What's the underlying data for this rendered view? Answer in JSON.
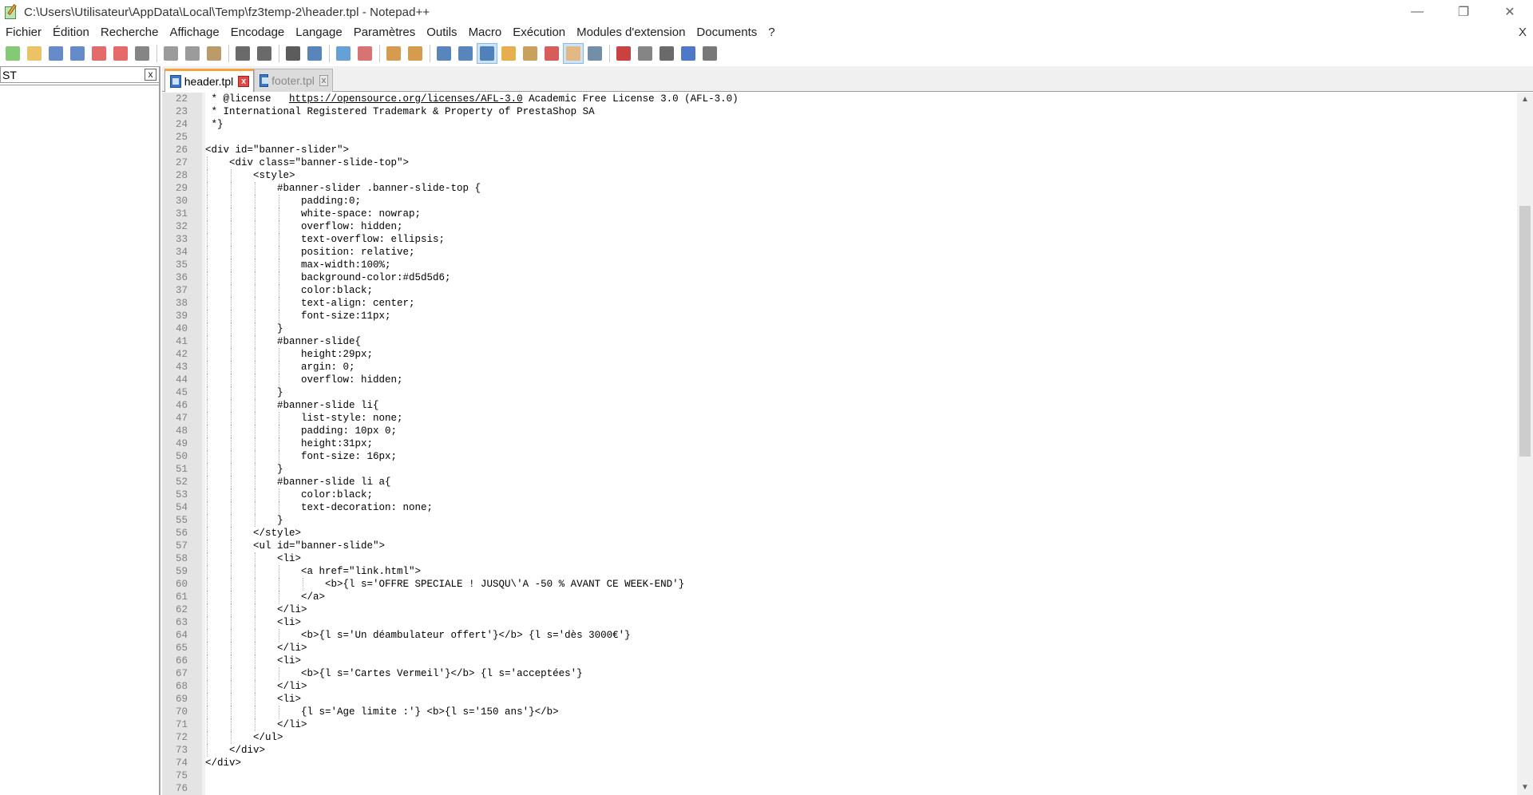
{
  "window": {
    "title": "C:\\Users\\Utilisateur\\AppData\\Local\\Temp\\fz3temp-2\\header.tpl - Notepad++",
    "minimize": "—",
    "restore": "❐",
    "close": "✕"
  },
  "menu": {
    "items": [
      "Fichier",
      "Édition",
      "Recherche",
      "Affichage",
      "Encodage",
      "Langage",
      "Paramètres",
      "Outils",
      "Macro",
      "Exécution",
      "Modules d'extension",
      "Documents",
      "?"
    ],
    "close": "X"
  },
  "toolbar": {
    "buttons": [
      {
        "name": "new-file",
        "color": "#6fbf5a"
      },
      {
        "name": "open-file",
        "color": "#e6b94a"
      },
      {
        "name": "save",
        "color": "#4a78c0"
      },
      {
        "name": "save-all",
        "color": "#4a78c0"
      },
      {
        "name": "close",
        "color": "#e05050"
      },
      {
        "name": "close-all",
        "color": "#e05050"
      },
      {
        "name": "print",
        "color": "#707070"
      },
      {
        "sep": true
      },
      {
        "name": "cut",
        "color": "#8a8a8a"
      },
      {
        "name": "copy",
        "color": "#8a8a8a"
      },
      {
        "name": "paste",
        "color": "#b08a50"
      },
      {
        "sep": true
      },
      {
        "name": "undo",
        "color": "#505050"
      },
      {
        "name": "redo",
        "color": "#505050"
      },
      {
        "sep": true
      },
      {
        "name": "find",
        "color": "#404040"
      },
      {
        "name": "replace",
        "color": "#3a70b0"
      },
      {
        "sep": true
      },
      {
        "name": "zoom-in",
        "color": "#4a90d0"
      },
      {
        "name": "zoom-out",
        "color": "#d05a5a"
      },
      {
        "sep": true
      },
      {
        "name": "sync-vertical",
        "color": "#d08a30"
      },
      {
        "name": "sync-horizontal",
        "color": "#d08a30"
      },
      {
        "sep": true
      },
      {
        "name": "word-wrap",
        "color": "#3a70b0"
      },
      {
        "name": "show-all-chars",
        "color": "#3a70b0"
      },
      {
        "name": "indent-guide",
        "color": "#3a70b0",
        "active": true
      },
      {
        "name": "user-language",
        "color": "#e0a030"
      },
      {
        "name": "doc-map",
        "color": "#c09040"
      },
      {
        "name": "function-list",
        "color": "#d04040"
      },
      {
        "name": "folder-workspace",
        "color": "#e8b070",
        "active": true
      },
      {
        "name": "monitoring",
        "color": "#5a7a9a"
      },
      {
        "sep": true
      },
      {
        "name": "macro-record",
        "color": "#c02020"
      },
      {
        "name": "macro-stop",
        "color": "#707070"
      },
      {
        "name": "macro-play",
        "color": "#505050"
      },
      {
        "name": "macro-play-multiple",
        "color": "#3060c0"
      },
      {
        "name": "macro-save",
        "color": "#606060"
      }
    ]
  },
  "left_panel": {
    "search_value": "ST",
    "close": "x"
  },
  "tabs": [
    {
      "label": "header.tpl",
      "active": true,
      "close": "x"
    },
    {
      "label": "footer.tpl",
      "active": false,
      "close": "x"
    }
  ],
  "editor": {
    "lines": [
      {
        "n": "22",
        "indent": 0,
        "text": " * @license   ",
        "link": "https://opensource.org/licenses/AFL-3.0",
        "after": " Academic Free License 3.0 (AFL-3.0)"
      },
      {
        "n": "23",
        "indent": 0,
        "text": " * International Registered Trademark & Property of PrestaShop SA"
      },
      {
        "n": "24",
        "indent": 0,
        "text": " *}"
      },
      {
        "n": "25",
        "indent": 0,
        "text": ""
      },
      {
        "n": "26",
        "indent": 0,
        "text": "<div id=\"banner-slider\">"
      },
      {
        "n": "27",
        "indent": 1,
        "text": "    <div class=\"banner-slide-top\">"
      },
      {
        "n": "28",
        "indent": 2,
        "text": "        <style>"
      },
      {
        "n": "29",
        "indent": 3,
        "text": "            #banner-slider .banner-slide-top {"
      },
      {
        "n": "30",
        "indent": 4,
        "text": "                padding:0;"
      },
      {
        "n": "31",
        "indent": 4,
        "text": "                white-space: nowrap;"
      },
      {
        "n": "32",
        "indent": 4,
        "text": "                overflow: hidden;"
      },
      {
        "n": "33",
        "indent": 4,
        "text": "                text-overflow: ellipsis;"
      },
      {
        "n": "34",
        "indent": 4,
        "text": "                position: relative;"
      },
      {
        "n": "35",
        "indent": 4,
        "text": "                max-width:100%;"
      },
      {
        "n": "36",
        "indent": 4,
        "text": "                background-color:#d5d5d6;"
      },
      {
        "n": "37",
        "indent": 4,
        "text": "                color:black;"
      },
      {
        "n": "38",
        "indent": 4,
        "text": "                text-align: center;"
      },
      {
        "n": "39",
        "indent": 4,
        "text": "                font-size:11px;"
      },
      {
        "n": "40",
        "indent": 3,
        "text": "            }"
      },
      {
        "n": "41",
        "indent": 3,
        "text": "            #banner-slide{"
      },
      {
        "n": "42",
        "indent": 4,
        "text": "                height:29px;"
      },
      {
        "n": "43",
        "indent": 4,
        "text": "                argin: 0;"
      },
      {
        "n": "44",
        "indent": 4,
        "text": "                overflow: hidden;"
      },
      {
        "n": "45",
        "indent": 3,
        "text": "            }"
      },
      {
        "n": "46",
        "indent": 3,
        "text": "            #banner-slide li{"
      },
      {
        "n": "47",
        "indent": 4,
        "text": "                list-style: none;"
      },
      {
        "n": "48",
        "indent": 4,
        "text": "                padding: 10px 0;"
      },
      {
        "n": "49",
        "indent": 4,
        "text": "                height:31px;"
      },
      {
        "n": "50",
        "indent": 4,
        "text": "                font-size: 16px;"
      },
      {
        "n": "51",
        "indent": 3,
        "text": "            }"
      },
      {
        "n": "52",
        "indent": 3,
        "text": "            #banner-slide li a{"
      },
      {
        "n": "53",
        "indent": 4,
        "text": "                color:black;"
      },
      {
        "n": "54",
        "indent": 4,
        "text": "                text-decoration: none;"
      },
      {
        "n": "55",
        "indent": 3,
        "text": "            }"
      },
      {
        "n": "56",
        "indent": 2,
        "text": "        </style>"
      },
      {
        "n": "57",
        "indent": 2,
        "text": "        <ul id=\"banner-slide\">"
      },
      {
        "n": "58",
        "indent": 3,
        "text": "            <li>"
      },
      {
        "n": "59",
        "indent": 4,
        "text": "                <a href=\"link.html\">"
      },
      {
        "n": "60",
        "indent": 5,
        "text": "                    <b>{l s='OFFRE SPECIALE ! JUSQU\\'A -50 % AVANT CE WEEK-END'}"
      },
      {
        "n": "61",
        "indent": 4,
        "text": "                </a>"
      },
      {
        "n": "62",
        "indent": 3,
        "text": "            </li>"
      },
      {
        "n": "63",
        "indent": 3,
        "text": "            <li>"
      },
      {
        "n": "64",
        "indent": 4,
        "text": "                <b>{l s='Un déambulateur offert'}</b> {l s='dès 3000€'}"
      },
      {
        "n": "65",
        "indent": 3,
        "text": "            </li>"
      },
      {
        "n": "66",
        "indent": 3,
        "text": "            <li>"
      },
      {
        "n": "67",
        "indent": 4,
        "text": "                <b>{l s='Cartes Vermeil'}</b> {l s='acceptées'}"
      },
      {
        "n": "68",
        "indent": 3,
        "text": "            </li>"
      },
      {
        "n": "69",
        "indent": 3,
        "text": "            <li>"
      },
      {
        "n": "70",
        "indent": 4,
        "text": "                {l s='Age limite :'} <b>{l s='150 ans'}</b>"
      },
      {
        "n": "71",
        "indent": 3,
        "text": "            </li>"
      },
      {
        "n": "72",
        "indent": 2,
        "text": "        </ul>"
      },
      {
        "n": "73",
        "indent": 1,
        "text": "    </div>"
      },
      {
        "n": "74",
        "indent": 0,
        "text": "</div>"
      },
      {
        "n": "75",
        "indent": 0,
        "text": ""
      },
      {
        "n": "76",
        "indent": 0,
        "text": ""
      }
    ]
  },
  "scrollbar": {
    "up": "▲",
    "down": "▼"
  }
}
